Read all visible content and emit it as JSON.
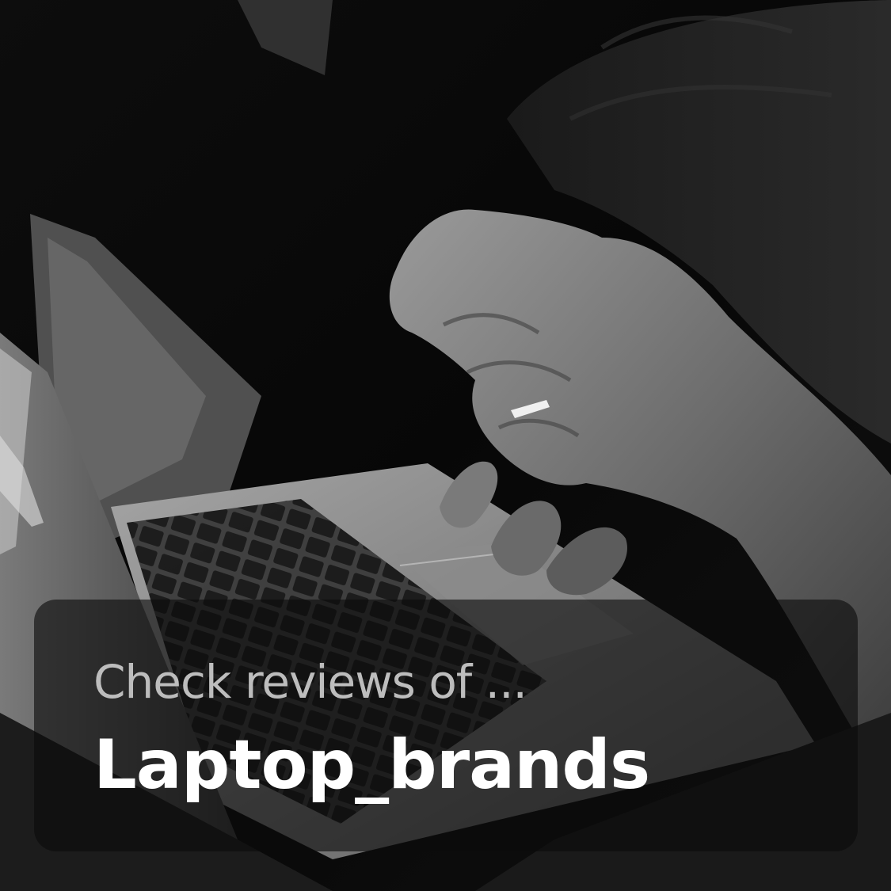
{
  "caption": {
    "subtitle": "Check reviews of ...",
    "title": "Laptop_brands"
  },
  "colors": {
    "card_background": "#0c0c0c",
    "subtitle_text": "#bdbdbd",
    "title_text": "#ffffff"
  }
}
